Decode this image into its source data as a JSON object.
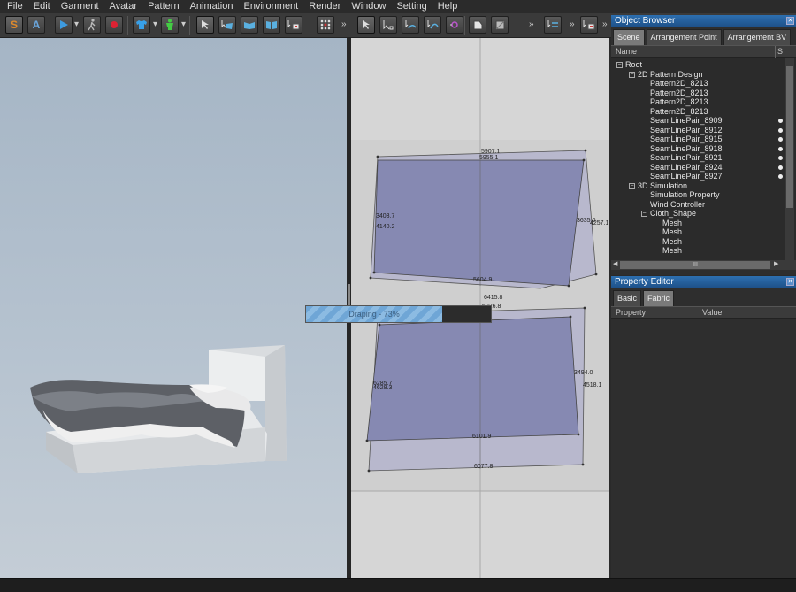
{
  "menu": [
    "File",
    "Edit",
    "Garment",
    "Avatar",
    "Pattern",
    "Animation",
    "Environment",
    "Render",
    "Window",
    "Setting",
    "Help"
  ],
  "toolbar": {
    "s_label": "S",
    "a_label": "A",
    "more": "»"
  },
  "icons": {
    "play": "play-icon",
    "record": "record-icon",
    "walk": "walk-icon",
    "shirt": "shirt-icon",
    "avatar": "avatar-icon",
    "select": "select-arrow-icon"
  },
  "progress": {
    "label": "Draping - 73%",
    "value": 0.73
  },
  "pattern_labels": {
    "a1": "5907.1",
    "a2": "5955.1",
    "a3": "3403.7",
    "a4": "4140.2",
    "a5": "3635.0",
    "a6": "4257.1",
    "a7": "5604.9",
    "a8": "6415.8",
    "b1": "5926.8",
    "b2": "6285.7",
    "b3": "4628.3",
    "b4": "3494.0",
    "b5": "4518.1",
    "b6": "6101.9",
    "b7": "6077.8"
  },
  "object_browser": {
    "title": "Object Browser",
    "tabs": [
      "Scene",
      "Arrangement Point",
      "Arrangement BV"
    ],
    "col_name": "Name",
    "col_s": "S",
    "tree": [
      {
        "label": "Root",
        "level": 0,
        "toggle": "−",
        "dot": false
      },
      {
        "label": "2D Pattern Design",
        "level": 1,
        "toggle": "−",
        "dot": false
      },
      {
        "label": "Pattern2D_8213",
        "level": 2,
        "toggle": "",
        "dot": false
      },
      {
        "label": "Pattern2D_8213",
        "level": 2,
        "toggle": "",
        "dot": false
      },
      {
        "label": "Pattern2D_8213",
        "level": 2,
        "toggle": "",
        "dot": false
      },
      {
        "label": "Pattern2D_8213",
        "level": 2,
        "toggle": "",
        "dot": false
      },
      {
        "label": "SeamLinePair_8909",
        "level": 2,
        "toggle": "",
        "dot": true
      },
      {
        "label": "SeamLinePair_8912",
        "level": 2,
        "toggle": "",
        "dot": true
      },
      {
        "label": "SeamLinePair_8915",
        "level": 2,
        "toggle": "",
        "dot": true
      },
      {
        "label": "SeamLinePair_8918",
        "level": 2,
        "toggle": "",
        "dot": true
      },
      {
        "label": "SeamLinePair_8921",
        "level": 2,
        "toggle": "",
        "dot": true
      },
      {
        "label": "SeamLinePair_8924",
        "level": 2,
        "toggle": "",
        "dot": true
      },
      {
        "label": "SeamLinePair_8927",
        "level": 2,
        "toggle": "",
        "dot": true
      },
      {
        "label": "3D Simulation",
        "level": 1,
        "toggle": "−",
        "dot": false
      },
      {
        "label": "Simulation Property",
        "level": 2,
        "toggle": "",
        "dot": false
      },
      {
        "label": "Wind Controller",
        "level": 2,
        "toggle": "",
        "dot": false
      },
      {
        "label": "Cloth_Shape",
        "level": 2,
        "toggle": "−",
        "dot": false
      },
      {
        "label": "Mesh",
        "level": 3,
        "toggle": "",
        "dot": false
      },
      {
        "label": "Mesh",
        "level": 3,
        "toggle": "",
        "dot": false
      },
      {
        "label": "Mesh",
        "level": 3,
        "toggle": "",
        "dot": false
      },
      {
        "label": "Mesh",
        "level": 3,
        "toggle": "",
        "dot": false
      }
    ],
    "hscroll": "III"
  },
  "property_editor": {
    "title": "Property Editor",
    "tabs": [
      "Basic",
      "Fabric"
    ],
    "col_property": "Property",
    "col_value": "Value"
  },
  "colors": {
    "pattern_fill": "#8a8cb4",
    "accent": "#2d6fb0",
    "progress": "#7ab0dc"
  }
}
